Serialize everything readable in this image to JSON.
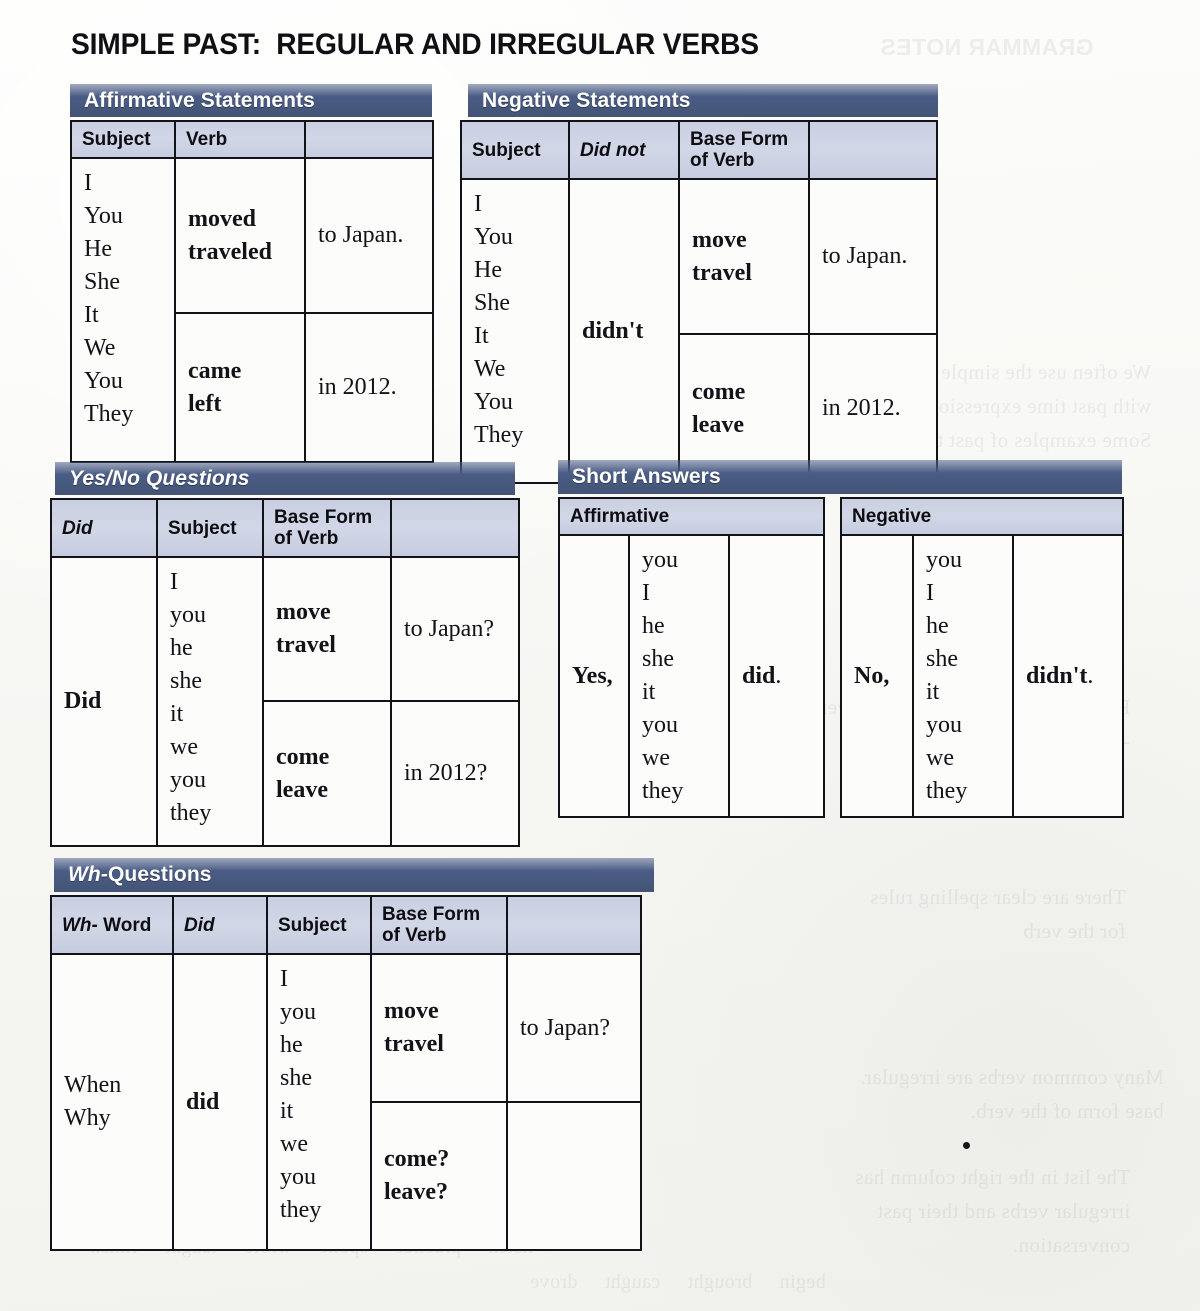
{
  "page": {
    "title": "SIMPLE PAST:  REGULAR AND IRREGULAR VERBS",
    "banner_color": "#4a5c86",
    "header_cell_color": "#ccd2e4",
    "border_color": "#121218"
  },
  "affirmative_statements": {
    "banner": "Affirmative Statements",
    "headers": [
      "Subject",
      "Verb",
      ""
    ],
    "subject": "I\nYou\nHe\nShe\nIt\nWe\nYou\nThey",
    "rows": [
      {
        "verb": "moved\ntraveled",
        "complement": "to Japan."
      },
      {
        "verb": "came\nleft",
        "complement": "in 2012."
      }
    ]
  },
  "negative_statements": {
    "banner": "Negative Statements",
    "headers": [
      "Subject",
      "Did not",
      "Base Form\nof Verb",
      ""
    ],
    "subject": "I\nYou\nHe\nShe\nIt\nWe\nYou\nThey",
    "did_not": "didn't",
    "rows": [
      {
        "verb": "move\ntravel",
        "complement": "to Japan."
      },
      {
        "verb": "come\nleave",
        "complement": "in 2012."
      }
    ]
  },
  "yes_no_questions": {
    "banner": "Yes/No Questions",
    "headers": [
      "Did",
      "Subject",
      "Base Form\nof Verb",
      ""
    ],
    "did": "Did",
    "subject": "I\nyou\nhe\nshe\nit\nwe\nyou\nthey",
    "rows": [
      {
        "verb": "move\ntravel",
        "complement": "to Japan?"
      },
      {
        "verb": "come\nleave",
        "complement": "in 2012?"
      }
    ]
  },
  "short_answers": {
    "banner": "Short Answers",
    "affirmative": {
      "header": "Affirmative",
      "lead": "Yes,",
      "subject": "you\nI\nhe\nshe\nit\nyou\nwe\nthey",
      "auxiliary": "did",
      "auxiliary_period": "."
    },
    "negative": {
      "header": "Negative",
      "lead": "No,",
      "subject": "you\nI\nhe\nshe\nit\nyou\nwe\nthey",
      "auxiliary": "didn't",
      "auxiliary_period": "."
    }
  },
  "wh_questions": {
    "banner": "Wh- Questions",
    "banner_italic_part": "Wh-",
    "banner_rest": " Questions",
    "headers": [
      "Wh- Word",
      "Did",
      "Subject",
      "Base Form\nof Verb",
      ""
    ],
    "wh_word": "When\nWhy",
    "did": "did",
    "subject": "I\nyou\nhe\nshe\nit\nwe\nyou\nthey",
    "rows": [
      {
        "verb": "move\ntravel",
        "complement": "to Japan?"
      },
      {
        "verb": "come?\nleave?",
        "complement": ""
      }
    ]
  }
}
